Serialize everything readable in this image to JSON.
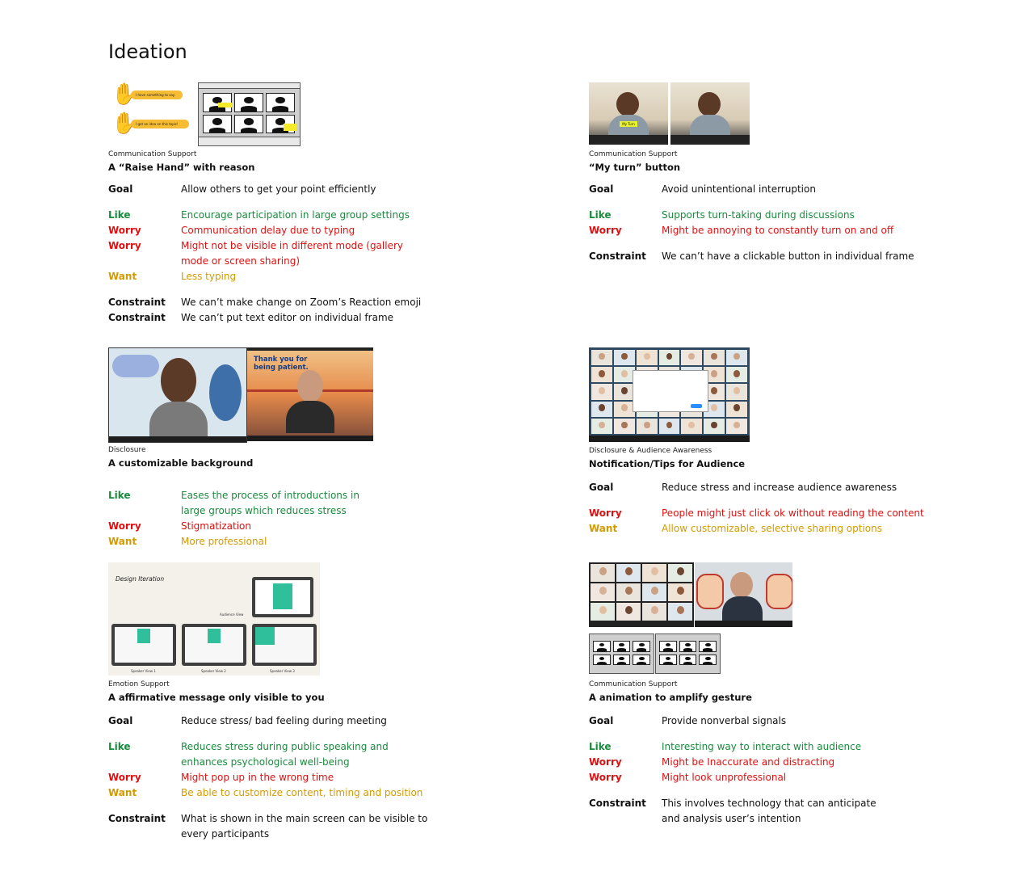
{
  "page_title": "Ideation",
  "colors": {
    "like": "#1a8a3d",
    "worry": "#e01010",
    "want": "#d39a00",
    "text": "#111111"
  },
  "raise_hand_art": {
    "bubble1": "I have something to say.",
    "bubble2": "I got an idea on this topic!"
  },
  "my_turn_art": {
    "badge": "My Turn"
  },
  "bg_art": {
    "banner": "Thank you for being patient."
  },
  "design_art": {
    "title": "Design Iteration",
    "audience": "Audience View",
    "speaker1": "Speaker View 1",
    "speaker2": "Speaker View 2",
    "speaker3": "Speaker View 3"
  },
  "cards": {
    "raise_hand": {
      "category": "Communication Support",
      "title": "A “Raise Hand” with reason",
      "rows": [
        {
          "label": "Goal",
          "text": "Allow others to get your point efficiently"
        },
        {
          "label": "Like",
          "text": "Encourage participation in large group settings"
        },
        {
          "label": "Worry",
          "text": "Communication delay due to typing"
        },
        {
          "label": "Worry",
          "text": "Might not be visible in different mode (gallery mode or screen sharing)"
        },
        {
          "label": "Want",
          "text": "Less typing"
        },
        {
          "label": "Constraint",
          "text": "We can’t make change on Zoom’s Reaction emoji"
        },
        {
          "label": "Constraint",
          "text": "We can’t put text editor on individual frame"
        }
      ]
    },
    "my_turn": {
      "category": "Communication Support",
      "title": "“My turn” button",
      "rows": [
        {
          "label": "Goal",
          "text": "Avoid unintentional interruption"
        },
        {
          "label": "Like",
          "text": "Supports turn-taking during discussions"
        },
        {
          "label": "Worry",
          "text": "Might be annoying to constantly turn on and off"
        },
        {
          "label": "Constraint",
          "text": "We can’t have a clickable button in individual frame"
        }
      ]
    },
    "background": {
      "category": "Disclosure",
      "title": "A customizable background",
      "rows": [
        {
          "label": "Like",
          "text": "Eases the process of introductions in large groups which reduces stress"
        },
        {
          "label": "Worry",
          "text": "Stigmatization"
        },
        {
          "label": "Want",
          "text": "More professional"
        }
      ]
    },
    "notification": {
      "category": "Disclosure & Audience Awareness",
      "title": "Notification/Tips for Audience",
      "rows": [
        {
          "label": "Goal",
          "text": "Reduce stress and increase audience awareness"
        },
        {
          "label": "Worry",
          "text": "People might just click ok without reading the content"
        },
        {
          "label": "Want",
          "text": "Allow customizable, selective sharing options"
        }
      ]
    },
    "affirmative": {
      "category": "Emotion Support",
      "title": "A affirmative message only visible to you",
      "rows": [
        {
          "label": "Goal",
          "text": "Reduce stress/ bad feeling during meeting"
        },
        {
          "label": "Like",
          "text": "Reduces stress during public speaking and enhances psychological well-being"
        },
        {
          "label": "Worry",
          "text": "Might pop up in the wrong time"
        },
        {
          "label": "Want",
          "text": "Be able to customize content, timing and position"
        },
        {
          "label": "Constraint",
          "text": "What is shown in the main screen can be visible to every participants"
        }
      ]
    },
    "gesture": {
      "category": "Communication Support",
      "title": "A animation to amplify gesture",
      "rows": [
        {
          "label": "Goal",
          "text": "Provide nonverbal signals"
        },
        {
          "label": "Like",
          "text": "Interesting way to interact with audience"
        },
        {
          "label": "Worry",
          "text": "Might be Inaccurate and distracting"
        },
        {
          "label": "Worry",
          "text": "Might look unprofessional"
        },
        {
          "label": "Constraint",
          "text": "This involves technology that can anticipate and analysis user’s intention"
        }
      ]
    }
  }
}
